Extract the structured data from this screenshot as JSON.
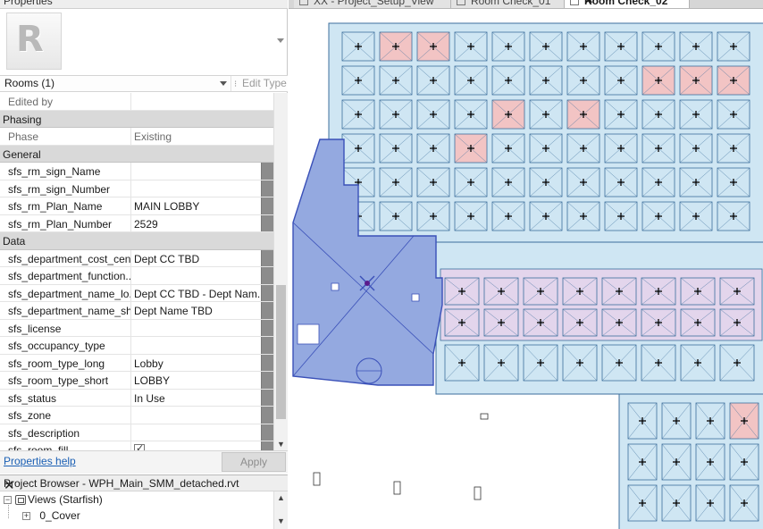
{
  "properties_panel": {
    "title": "Properties",
    "filter_label": "Rooms (1)",
    "edit_type_label": "Edit Type",
    "help_link": "Properties help",
    "apply_label": "Apply",
    "rows": [
      {
        "kind": "row",
        "name": "Edited by",
        "value": "",
        "readonly": true
      },
      {
        "kind": "group",
        "name": "Phasing"
      },
      {
        "kind": "row",
        "name": "Phase",
        "value": "Existing",
        "readonly": true
      },
      {
        "kind": "group",
        "name": "General"
      },
      {
        "kind": "row",
        "name": "sfs_rm_sign_Name",
        "value": ""
      },
      {
        "kind": "row",
        "name": "sfs_rm_sign_Number",
        "value": ""
      },
      {
        "kind": "row",
        "name": "sfs_rm_Plan_Name",
        "value": "MAIN LOBBY"
      },
      {
        "kind": "row",
        "name": "sfs_rm_Plan_Number",
        "value": "2529"
      },
      {
        "kind": "group",
        "name": "Data"
      },
      {
        "kind": "row",
        "name": "sfs_department_cost_cen...",
        "value": "Dept CC TBD"
      },
      {
        "kind": "row",
        "name": "sfs_department_function...",
        "value": ""
      },
      {
        "kind": "row",
        "name": "sfs_department_name_lo...",
        "value": "Dept CC TBD - Dept Nam..."
      },
      {
        "kind": "row",
        "name": "sfs_department_name_sh...",
        "value": "Dept Name TBD"
      },
      {
        "kind": "row",
        "name": "sfs_license",
        "value": ""
      },
      {
        "kind": "row",
        "name": "sfs_occupancy_type",
        "value": ""
      },
      {
        "kind": "row",
        "name": "sfs_room_type_long",
        "value": "Lobby"
      },
      {
        "kind": "row",
        "name": "sfs_room_type_short",
        "value": "LOBBY"
      },
      {
        "kind": "row",
        "name": "sfs_status",
        "value": "In Use"
      },
      {
        "kind": "row",
        "name": "sfs_zone",
        "value": ""
      },
      {
        "kind": "row",
        "name": "sfs_description",
        "value": ""
      },
      {
        "kind": "row",
        "name": "sfs_room_fill",
        "value": "",
        "checkbox": true,
        "checked": true
      }
    ]
  },
  "project_browser": {
    "title": "Project Browser - WPH_Main_SMM_detached.rvt",
    "tree": [
      {
        "label": "Views (Starfish)",
        "toggle": "−",
        "icon": "views-icon"
      },
      {
        "label": "0_Cover",
        "toggle": "+"
      }
    ]
  },
  "view_tabs": [
    {
      "label": "XX - Project_Setup_View",
      "active": false
    },
    {
      "label": "Room Check_01",
      "active": false
    },
    {
      "label": "Room Check_02",
      "active": true
    }
  ],
  "floor_plan": {
    "colors": {
      "room_blue": "#cfe6f3",
      "room_pink": "#f2c4c4",
      "room_lilac": "#e3d5ec",
      "selected_room": "#94a9e0",
      "selected_outline": "#3a50b8",
      "wall_line": "#3c6f9c",
      "room_mark": "#111111"
    }
  }
}
